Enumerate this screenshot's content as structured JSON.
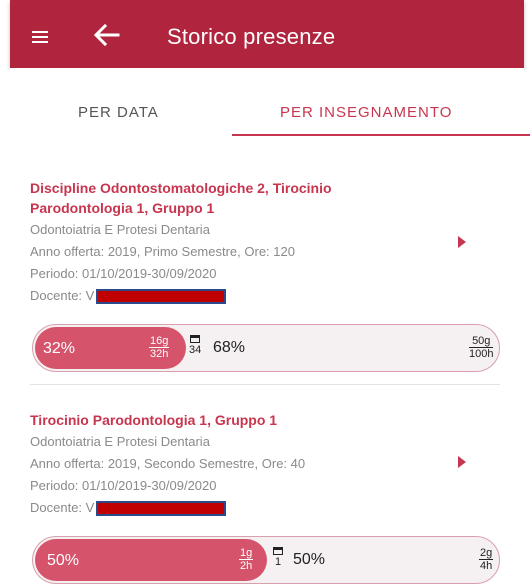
{
  "header": {
    "title": "Storico presenze"
  },
  "tabs": [
    {
      "label": "PER DATA",
      "active": false
    },
    {
      "label": "PER INSEGNAMENTO",
      "active": true
    }
  ],
  "colors": {
    "primary": "#b0243e",
    "accent": "#c8354f",
    "fill": "#d5546c"
  },
  "courses": [
    {
      "title_line1": "Discipline Odontostomatologiche 2, Tirocinio",
      "title_line2": "Parodontologia 1, Gruppo 1",
      "degree": "Odontoiatria E Protesi Dentaria",
      "offer": "Anno offerta: 2019, Primo Semestre, Ore: 120",
      "period": "Periodo: 01/10/2019-30/09/2020",
      "teacher_prefix": "Docente: V",
      "progress": {
        "attended_pct": 32,
        "attended_label": "32%",
        "attended_days": "16g",
        "attended_hours": "32h",
        "calendar_count": "34",
        "remaining_label": "68%",
        "total_days": "50g",
        "total_hours": "100h"
      }
    },
    {
      "title_line1": "Tirocinio Parodontologia 1, Gruppo 1",
      "degree": "Odontoiatria E Protesi Dentaria",
      "offer": "Anno offerta: 2019, Secondo Semestre, Ore: 40",
      "period": "Periodo: 01/10/2019-30/09/2020",
      "teacher_prefix": "Docente: V",
      "progress": {
        "attended_pct": 50,
        "attended_label": "50%",
        "attended_days": "1g",
        "attended_hours": "2h",
        "calendar_count": "1",
        "remaining_label": "50%",
        "total_days": "2g",
        "total_hours": "4h"
      }
    }
  ],
  "icons": [
    "menu-icon",
    "back-arrow-icon",
    "chevron-right-icon",
    "calendar-icon"
  ]
}
